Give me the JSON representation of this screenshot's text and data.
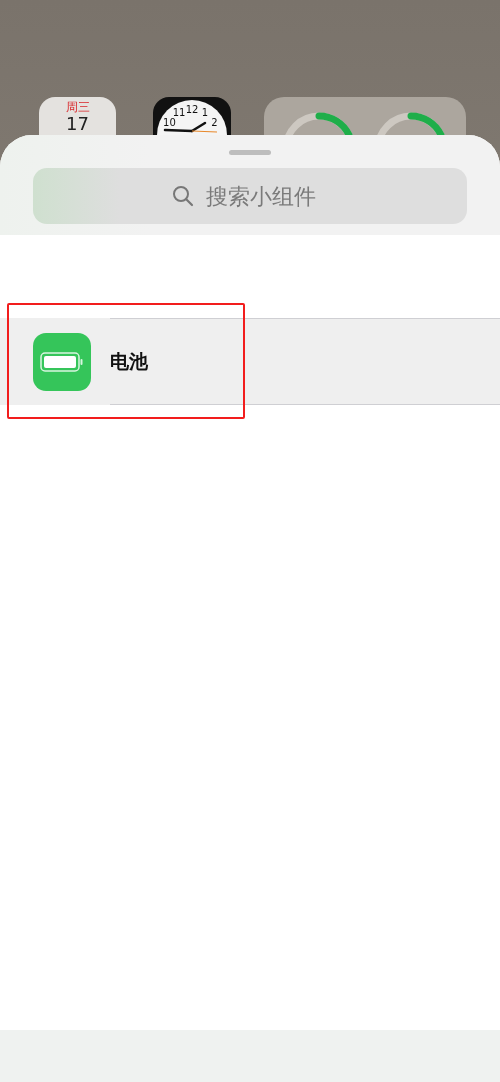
{
  "widgets": {
    "calendar": {
      "weekday": "周三",
      "day": "17"
    },
    "clock": {
      "numerals": [
        "11",
        "12",
        "1",
        "10",
        "2"
      ]
    }
  },
  "search": {
    "placeholder": "搜索小组件"
  },
  "widget_list": [
    {
      "name": "电池",
      "kind": "battery"
    }
  ]
}
